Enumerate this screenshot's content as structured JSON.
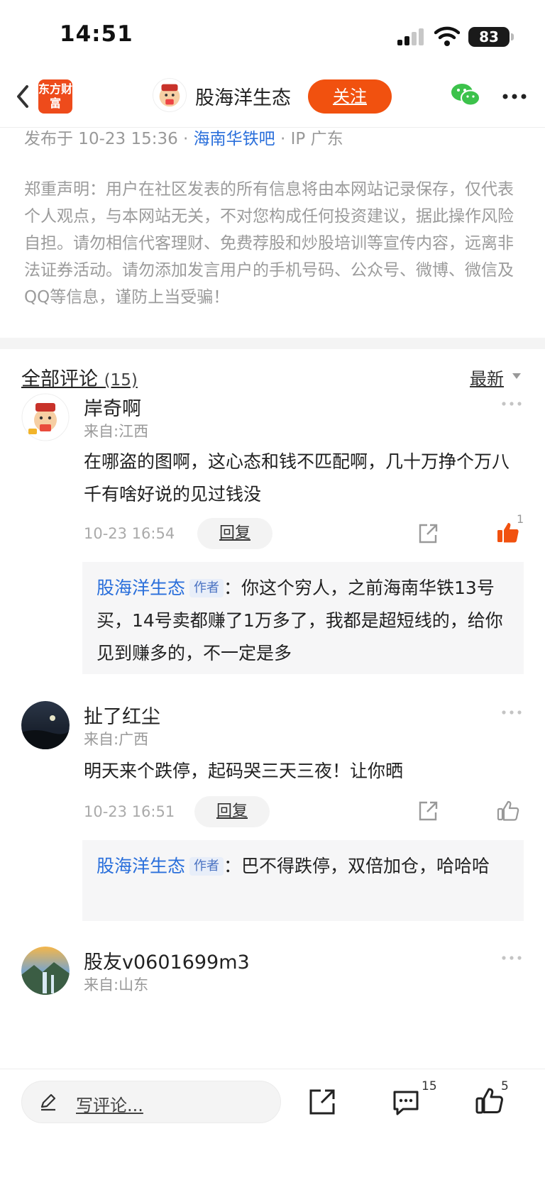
{
  "status_bar": {
    "time": "14:51",
    "battery": "83"
  },
  "header": {
    "logo_text": "东方财富",
    "title": "股海洋生态",
    "follow_label": "关注"
  },
  "post": {
    "meta_prefix": "发布于 10-23 15:36 · ",
    "bar_name": "海南华铁吧",
    "meta_suffix": " · IP 广东",
    "disclaimer": "郑重声明：用户在社区发表的所有信息将由本网站记录保存，仅代表个人观点，与本网站无关，不对您构成任何投资建议，据此操作风险自担。请勿相信代客理财、免费荐股和炒股培训等宣传内容，远离非法证券活动。请勿添加发言用户的手机号码、公众号、微博、微信及QQ等信息，谨防上当受骗！"
  },
  "comments_header": {
    "title": "全部评论",
    "count": "(15)",
    "sort": "最新"
  },
  "comments": [
    {
      "name": "岸奇啊",
      "from": "来自:江西",
      "text": "在哪盗的图啊，这心态和钱不匹配啊，几十万挣个万八千有啥好说的见过钱没",
      "time": "10-23 16:54",
      "reply_label": "回复",
      "like_count": "1",
      "reply": {
        "who": "股海洋生态",
        "tag": "作者",
        "text": "：你这个穷人，之前海南华铁13号买，14号卖都赚了1万多了，我都是超短线的，给你见到赚多的，不一定是多"
      }
    },
    {
      "name": "扯了红尘",
      "from": "来自:广西",
      "text": "明天来个跌停，起码哭三天三夜！让你晒",
      "time": "10-23 16:51",
      "reply_label": "回复",
      "like_count": "",
      "reply": {
        "who": "股海洋生态",
        "tag": "作者",
        "text": "：巴不得跌停，双倍加仓，哈哈哈"
      }
    },
    {
      "name": "股友v0601699m3",
      "from": "来自:山东"
    }
  ],
  "bottom_bar": {
    "placeholder": "写评论...",
    "comment_count": "15",
    "like_count": "5"
  },
  "colors": {
    "accent": "#f1510f",
    "link": "#2a6fdb",
    "like_active": "#f1510f"
  }
}
